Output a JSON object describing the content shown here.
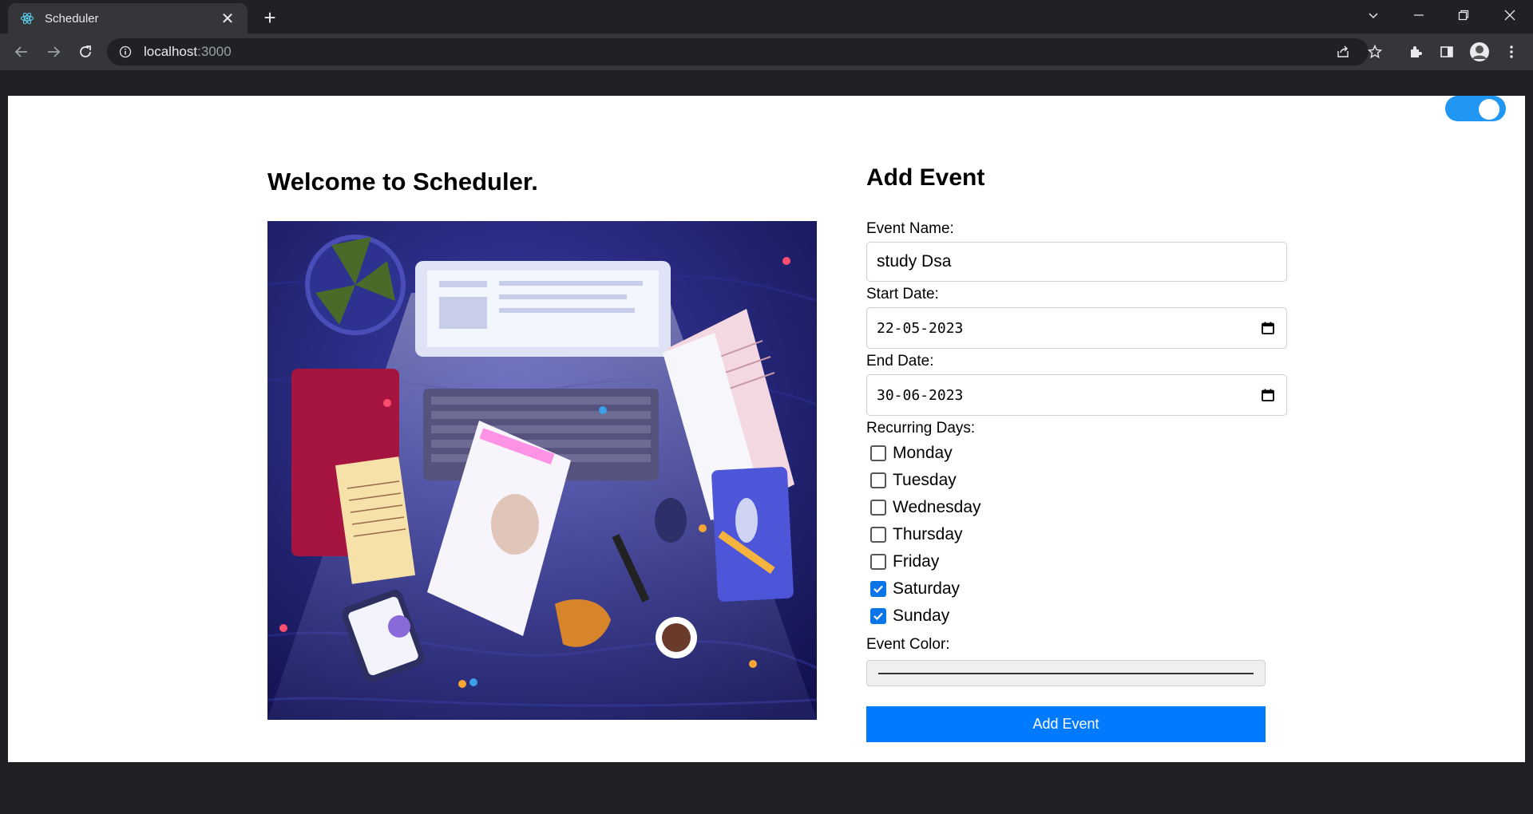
{
  "browser": {
    "tab_title": "Scheduler",
    "url_host": "localhost",
    "url_port": ":3000"
  },
  "page": {
    "welcome_heading": "Welcome to Scheduler.",
    "dark_mode_toggle_on": true
  },
  "form": {
    "title": "Add Event",
    "event_name_label": "Event Name:",
    "event_name_value": "study Dsa",
    "start_date_label": "Start Date:",
    "start_date_value": "22-05-2023",
    "end_date_label": "End Date:",
    "end_date_value": "30-06-2023",
    "recurring_label": "Recurring Days:",
    "days": [
      {
        "label": "Monday",
        "checked": false
      },
      {
        "label": "Tuesday",
        "checked": false
      },
      {
        "label": "Wednesday",
        "checked": false
      },
      {
        "label": "Thursday",
        "checked": false
      },
      {
        "label": "Friday",
        "checked": false
      },
      {
        "label": "Saturday",
        "checked": true
      },
      {
        "label": "Sunday",
        "checked": true
      }
    ],
    "color_label": "Event Color:",
    "color_value": "#000000",
    "submit_label": "Add Event"
  },
  "colors": {
    "accent": "#007bff",
    "toggle": "#2196f3",
    "chrome_dark": "#202124",
    "chrome_toolbar": "#35363a"
  }
}
